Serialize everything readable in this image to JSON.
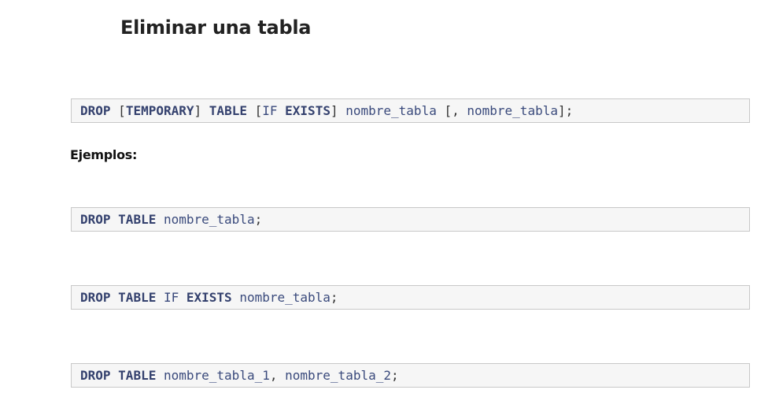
{
  "page": {
    "title": "Eliminar una tabla",
    "examples_label": "Ejemplos:"
  },
  "syntax": {
    "kw_drop": "DROP",
    "open_bracket": "[",
    "kw_temporary": "TEMPORARY",
    "close_bracket": "]",
    "kw_table": "TABLE",
    "open_bracket_2": "[",
    "kw_if": "IF",
    "kw_exists": "EXISTS",
    "close_bracket_2": "]",
    "table_name": "nombre_tabla",
    "optional_more": "[,",
    "table_name_2": "nombre_tabla",
    "terminator": "];"
  },
  "examples": [
    {
      "kw_drop": "DROP",
      "kw_table": "TABLE",
      "table_name": "nombre_tabla",
      "terminator": ";"
    },
    {
      "kw_drop": "DROP",
      "kw_table": "TABLE",
      "kw_if": "IF",
      "kw_exists": "EXISTS",
      "table_name": "nombre_tabla",
      "terminator": ";"
    },
    {
      "kw_drop": "DROP",
      "kw_table": "TABLE",
      "table_name_1": "nombre_tabla_1",
      "separator": ",",
      "table_name_2": "nombre_tabla_2",
      "terminator": ";"
    }
  ],
  "colors": {
    "keyword": "#34416e",
    "identifier": "#3a4a7c",
    "code_background": "#f6f6f6",
    "code_border": "#c8c8c8"
  }
}
